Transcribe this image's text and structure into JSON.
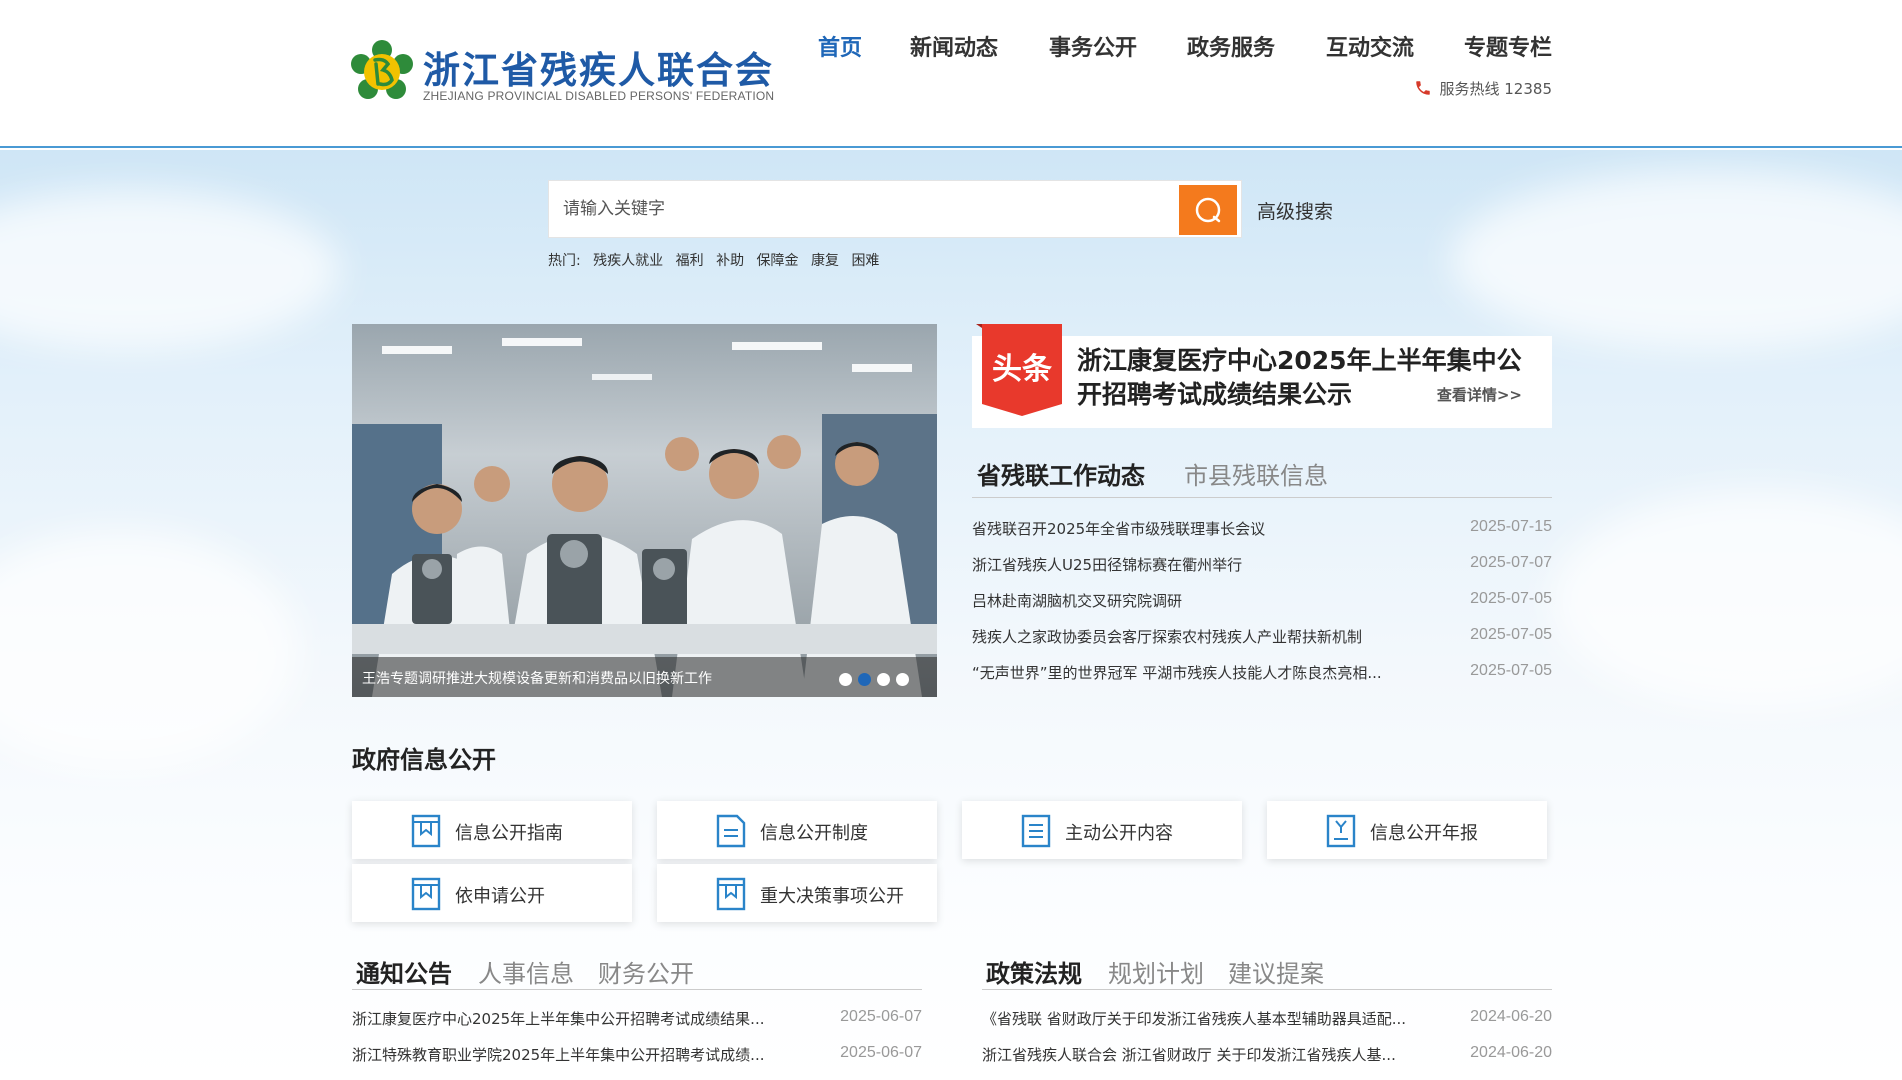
{
  "site": {
    "name_cn": "浙江省残疾人联合会",
    "name_en": "ZHEJIANG PROVINCIAL DISABLED PERSONS' FEDERATION"
  },
  "nav": [
    "首页",
    "新闻动态",
    "事务公开",
    "政务服务",
    "互动交流",
    "专题专栏"
  ],
  "nav_active": 0,
  "hotline": "服务热线 12385",
  "search": {
    "placeholder": "请输入关键字",
    "advanced": "高级搜索",
    "hot_label": "热门:",
    "hot_tags": [
      "残疾人就业",
      "福利",
      "补助",
      "保障金",
      "康复",
      "困难"
    ]
  },
  "carousel": {
    "caption": "王浩专题调研推进大规模设备更新和消费品以旧换新工作",
    "dots": 4,
    "active_dot": 1
  },
  "headline": {
    "badge": "头条",
    "title": "浙江康复医疗中心2025年上半年集中公开招聘考试成绩结果公示",
    "more": "查看详情>>"
  },
  "news": {
    "tabs": [
      "省残联工作动态",
      "市县残联信息"
    ],
    "items": [
      {
        "title": "省残联召开2025年全省市级残联理事长会议",
        "date": "2025-07-15"
      },
      {
        "title": "浙江省残疾人U25田径锦标赛在衢州举行",
        "date": "2025-07-07"
      },
      {
        "title": "吕林赴南湖脑机交叉研究院调研",
        "date": "2025-07-05"
      },
      {
        "title": "残疾人之家政协委员会客厅探索农村残疾人产业帮扶新机制",
        "date": "2025-07-05"
      },
      {
        "title": "“无声世界”里的世界冠军 平湖市残疾人技能人才陈良杰亮相...",
        "date": "2025-07-05"
      }
    ]
  },
  "gov": {
    "title": "政府信息公开",
    "cards": [
      "信息公开指南",
      "信息公开制度",
      "主动公开内容",
      "信息公开年报",
      "依申请公开",
      "重大决策事项公开"
    ]
  },
  "notices": {
    "tabs": [
      "通知公告",
      "人事信息",
      "财务公开"
    ],
    "items": [
      {
        "title": "浙江康复医疗中心2025年上半年集中公开招聘考试成绩结果...",
        "date": "2025-06-07"
      },
      {
        "title": "浙江特殊教育职业学院2025年上半年集中公开招聘考试成绩...",
        "date": "2025-06-07"
      }
    ]
  },
  "policy": {
    "tabs": [
      "政策法规",
      "规划计划",
      "建议提案"
    ],
    "items": [
      {
        "title": "《省残联 省财政厅关于印发浙江省残疾人基本型辅助器具适配...",
        "date": "2024-06-20"
      },
      {
        "title": "浙江省残疾人联合会 浙江省财政厅 关于印发浙江省残疾人基...",
        "date": "2024-06-20"
      }
    ]
  },
  "colors": {
    "brand_blue": "#1f67b8",
    "search_orange": "#f47a1d",
    "headline_red": "#e8392c",
    "logo_green": "#2e8b3a",
    "logo_yellow": "#f2c200"
  }
}
